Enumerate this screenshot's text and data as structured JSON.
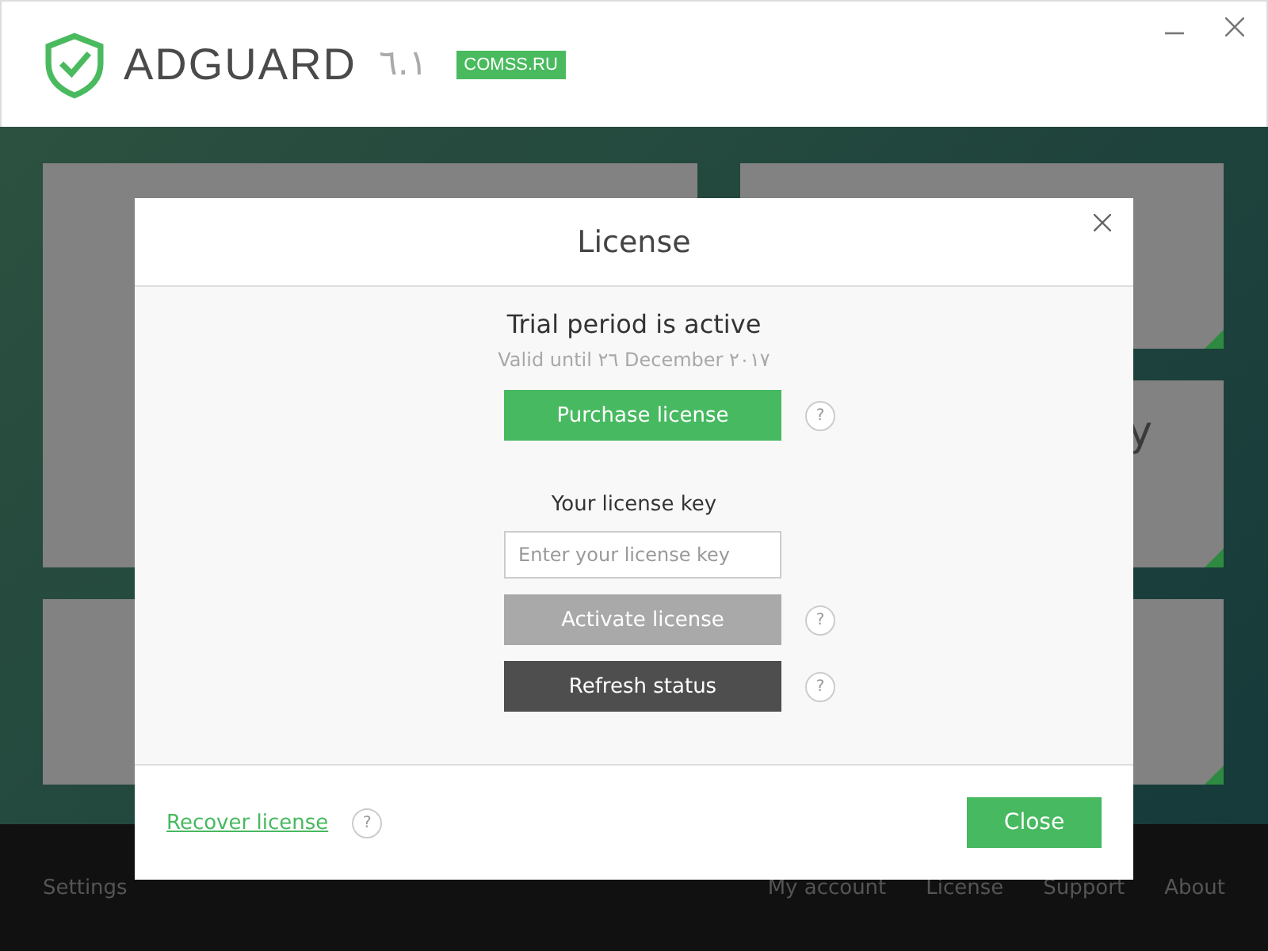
{
  "app": {
    "name": "ADGUARD",
    "version": "٦.١",
    "badge": "COMSS.RU"
  },
  "tile_text": "y",
  "footer": {
    "left": "Settings",
    "links": [
      "My account",
      "License",
      "Support",
      "About"
    ]
  },
  "dialog": {
    "title": "License",
    "status": "Trial period is active",
    "valid": "Valid until ٢٦ December ٢٠١٧",
    "purchase": "Purchase license",
    "key_label": "Your license key",
    "key_placeholder": "Enter your license key",
    "activate": {
      "label": "Activate license",
      "disabled": true
    },
    "refresh": "Refresh status",
    "help": "?",
    "recover": "Recover license",
    "close": "Close"
  }
}
